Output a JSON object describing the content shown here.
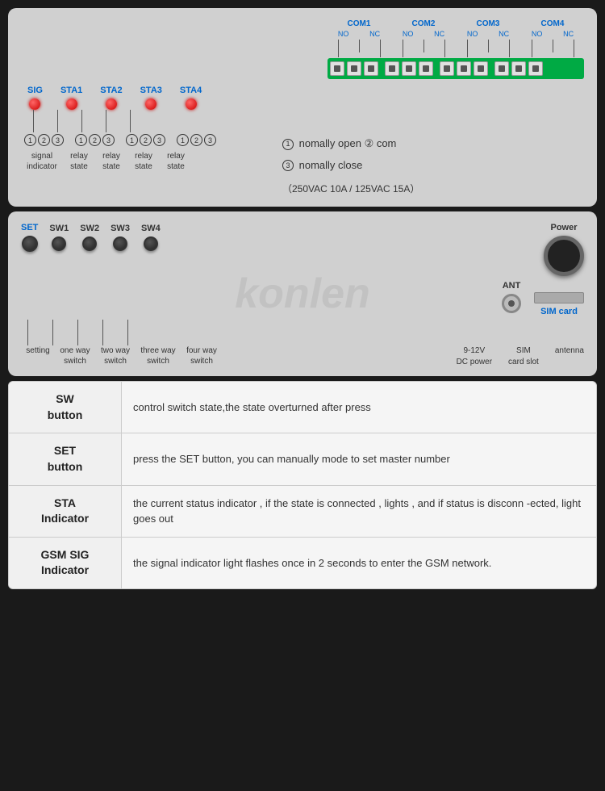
{
  "topPanel": {
    "comGroups": [
      {
        "title": "COM1",
        "subs": [
          "NO",
          "NC"
        ]
      },
      {
        "title": "COM2",
        "subs": [
          "NO",
          "NC"
        ]
      },
      {
        "title": "COM3",
        "subs": [
          "NO",
          "NC"
        ]
      },
      {
        "title": "COM4",
        "subs": [
          "NO",
          "NC"
        ]
      }
    ],
    "leds": [
      {
        "label": "SIG",
        "id": "sig"
      },
      {
        "label": "STA1",
        "id": "sta1"
      },
      {
        "label": "STA2",
        "id": "sta2"
      },
      {
        "label": "STA3",
        "id": "sta3"
      },
      {
        "label": "STA4",
        "id": "sta4"
      }
    ],
    "relayGroups": [
      [
        "1",
        "2",
        "3"
      ],
      [
        "1",
        "2",
        "3"
      ],
      [
        "1",
        "2",
        "3"
      ],
      [
        "1",
        "2",
        "3"
      ]
    ],
    "signalLabels": [
      {
        "line1": "signal",
        "line2": "indicator"
      },
      {
        "line1": "relay",
        "line2": "state"
      },
      {
        "line1": "relay",
        "line2": "state"
      },
      {
        "line1": "relay",
        "line2": "state"
      },
      {
        "line1": "relay",
        "line2": "state"
      }
    ],
    "relayInfo": [
      "① nomally open     ② com",
      "③ nomally close"
    ],
    "vacInfo": "（250VAC 10A / 125VAC 15A）"
  },
  "midPanel": {
    "watermark": "konlen",
    "buttons": [
      {
        "label": "SET",
        "id": "set"
      },
      {
        "label": "SW1",
        "id": "sw1"
      },
      {
        "label": "SW2",
        "id": "sw2"
      },
      {
        "label": "SW3",
        "id": "sw3"
      },
      {
        "label": "SW4",
        "id": "sw4"
      }
    ],
    "powerLabel": "Power",
    "antLabel": "ANT",
    "simLabel": "SIM card",
    "bottomLabels": [
      {
        "line1": "setting",
        "line2": ""
      },
      {
        "line1": "one way",
        "line2": "switch"
      },
      {
        "line1": "two way",
        "line2": "switch"
      },
      {
        "line1": "three way",
        "line2": "switch"
      },
      {
        "line1": "four way",
        "line2": "switch"
      }
    ],
    "rightLabels": [
      {
        "line1": "9-12V",
        "line2": "DC power"
      },
      {
        "line1": "SIM",
        "line2": "card slot"
      },
      {
        "line1": "antenna",
        "line2": ""
      }
    ]
  },
  "table": {
    "rows": [
      {
        "left": "SW\nbutton",
        "right": "control switch state,the state overturned after press"
      },
      {
        "left": "SET\nbutton",
        "right": "press the SET button, you can manually mode to set master number"
      },
      {
        "left": "STA\nIndicator",
        "right": "the current status indicator ,  if  the state is connected , lights , and if status is disconn -ected, light goes out"
      },
      {
        "left": "GSM SIG\nIndicator",
        "right": "the signal indicator light flashes once in 2 seconds to enter the GSM network."
      }
    ]
  }
}
